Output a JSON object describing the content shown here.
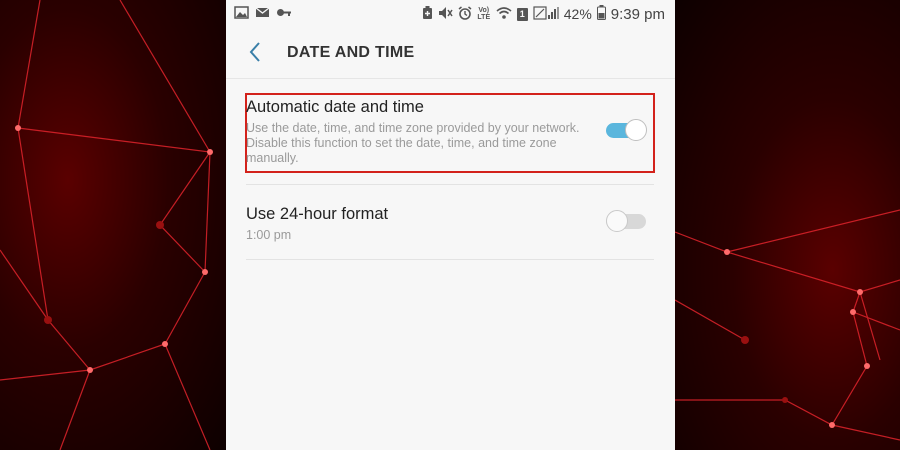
{
  "status_bar": {
    "left_icons": [
      "gallery-icon",
      "mail-icon",
      "key-icon"
    ],
    "right_icons": [
      "battery-saver-icon",
      "mute-icon",
      "alarm-icon",
      "volte-icon",
      "wifi-icon",
      "sim-icon",
      "signal-icon"
    ],
    "network_label": "Vo)\nLTE",
    "sim_label": "1",
    "battery": "42%",
    "time": "9:39 pm"
  },
  "header": {
    "back_icon": "chevron-left-icon",
    "title": "DATE AND TIME"
  },
  "settings": [
    {
      "title": "Automatic date and time",
      "description": "Use the date, time, and time zone provided by your network. Disable this function to set the date, time, and time zone manually.",
      "toggle_on": true
    },
    {
      "title": "Use 24-hour format",
      "description": "1:00 pm",
      "toggle_on": false
    }
  ],
  "colors": {
    "accent": "#5ab6dd",
    "highlight_border": "#d3221b",
    "back_arrow": "#3a7fa8"
  }
}
